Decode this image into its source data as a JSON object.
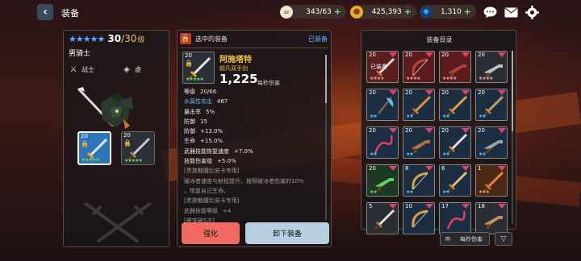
{
  "header": {
    "back_glyph": "‹",
    "title": "装备",
    "resources": [
      {
        "icon": "coffee-cup-icon",
        "value": "343/63",
        "color": "#f0e6d2"
      },
      {
        "icon": "gold-coin-icon",
        "value": "425,393",
        "color": "#f0a830"
      },
      {
        "icon": "gem-icon",
        "value": "1,310",
        "color": "#3aa0ff"
      }
    ],
    "plus": "+"
  },
  "hero": {
    "stars": 5,
    "level": "30",
    "level_max": "/30",
    "level_unit": "级",
    "name": "男骑士",
    "class_label": "战士",
    "element_label": "虚",
    "weapons": [
      {
        "level": "20",
        "stars": "★★★★★"
      },
      {
        "level": "20",
        "stars": "★★★★★"
      }
    ]
  },
  "selected": {
    "label": "选中的装备",
    "equipped_label": "已装备",
    "icon_level": "20",
    "icon_stars": "★★★★★",
    "name": "阿施塔特",
    "type": "超凡双手剑",
    "damage": "1,225",
    "damage_unit": "每秒伤害",
    "stats": [
      {
        "k": "等级",
        "v": "20/66",
        "k_style": "",
        "grey": false
      },
      {
        "k": "水属性攻击",
        "v": "467",
        "k_style": "blue",
        "grey": false
      },
      {
        "k": "暴击率",
        "v": "5%",
        "k_style": "",
        "grey": false
      },
      {
        "k": "防御",
        "v": "15",
        "k_style": "",
        "grey": false
      },
      {
        "k": "防御",
        "v": "+13.0%",
        "k_style": "",
        "grey": false
      },
      {
        "k": "生命",
        "v": "+15.0%",
        "k_style": "",
        "grey": false
      },
      {
        "k": "武器技能恢复速度",
        "v": "+7.0%",
        "k_style": "",
        "grey": false
      },
      {
        "k": "技能伤害值",
        "v": "+5.0%",
        "k_style": "",
        "grey": false
      },
      {
        "k": "[贵族魅魔比安卡专用]",
        "v": "",
        "k_style": "",
        "grey": true
      },
      {
        "k": "破冰者速度与射程提升，按照破冰者伤害的10%",
        "v": "",
        "k_style": "",
        "grey": true
      },
      {
        "k": "，恢复自己生命。",
        "v": "",
        "k_style": "",
        "grey": true
      },
      {
        "k": "[贵族魅魔比安卡专用]",
        "v": "",
        "k_style": "",
        "grey": true
      },
      {
        "k": "武器技能等级",
        "v": "+4",
        "k_style": "",
        "grey": true
      },
      {
        "k": "[需突破5次]",
        "v": "",
        "k_style": "",
        "grey": true
      }
    ],
    "upgrade_label": "强化",
    "unequip_label": "卸下装备"
  },
  "inventory": {
    "title": "装备目录",
    "items": [
      {
        "level": "20",
        "rarity": "r-red",
        "stars": "★★★★",
        "star_color": "#f0a0a0",
        "equipped": "已装备",
        "weapon": "sword",
        "color": "#d8d8d8"
      },
      {
        "level": "20",
        "rarity": "r-red",
        "stars": "★★★★",
        "star_color": "#f0a0a0",
        "equipped": "",
        "weapon": "bow",
        "color": "#c04040"
      },
      {
        "level": "20",
        "rarity": "r-red",
        "stars": "★★★★",
        "star_color": "#f0a0a0",
        "equipped": "",
        "weapon": "gun",
        "color": "#b04040"
      },
      {
        "level": "20",
        "rarity": "r-grey",
        "stars": "★★★★",
        "star_color": "#f0a0a0",
        "equipped": "",
        "weapon": "gun",
        "color": "#c0c0c0"
      },
      {
        "level": "20",
        "rarity": "r-blue",
        "stars": "★★",
        "star_color": "#5fc8ff",
        "equipped": "",
        "weapon": "axe",
        "color": "#60c0e0"
      },
      {
        "level": "20",
        "rarity": "r-blue",
        "stars": "★★",
        "star_color": "#5fc8ff",
        "equipped": "",
        "weapon": "sword",
        "color": "#e09040"
      },
      {
        "level": "20",
        "rarity": "r-blue",
        "stars": "★★",
        "star_color": "#5fc8ff",
        "equipped": "",
        "weapon": "sword",
        "color": "#e0a040"
      },
      {
        "level": "20",
        "rarity": "r-blue",
        "stars": "★★",
        "star_color": "#5fc8ff",
        "equipped": "",
        "weapon": "sword",
        "color": "#c0a060"
      },
      {
        "level": "20",
        "rarity": "r-blue",
        "stars": "★★",
        "star_color": "#5fc8ff",
        "equipped": "",
        "weapon": "whip",
        "color": "#e04060"
      },
      {
        "level": "20",
        "rarity": "r-blue",
        "stars": "★★",
        "star_color": "#5fc8ff",
        "equipped": "",
        "weapon": "gun",
        "color": "#c07040"
      },
      {
        "level": "20",
        "rarity": "r-blue",
        "stars": "★★",
        "star_color": "#5fc8ff",
        "equipped": "",
        "weapon": "sword",
        "color": "#e0e0e0"
      },
      {
        "level": "20",
        "rarity": "r-blue",
        "stars": "★★",
        "star_color": "#5fc8ff",
        "equipped": "",
        "weapon": "gun",
        "color": "#a0a0a0"
      },
      {
        "level": "20",
        "rarity": "r-green",
        "stars": "★★",
        "star_color": "#7ddc5d",
        "equipped": "",
        "weapon": "gun",
        "color": "#60d060"
      },
      {
        "level": "8",
        "rarity": "r-blue",
        "stars": "★★",
        "star_color": "#5fc8ff",
        "equipped": "",
        "weapon": "bow",
        "color": "#e0a040"
      },
      {
        "level": "6",
        "rarity": "r-blue",
        "stars": "★★",
        "star_color": "#5fc8ff",
        "equipped": "",
        "weapon": "sword",
        "color": "#e0c080"
      },
      {
        "level": "1",
        "rarity": "r-orange",
        "stars": "★★★",
        "star_color": "#f0a060",
        "equipped": "",
        "weapon": "sword",
        "color": "#f08040"
      },
      {
        "level": "5",
        "rarity": "r-grey",
        "stars": "",
        "star_color": "#ffffff",
        "equipped": "",
        "weapon": "sword",
        "color": "#e0e0e0"
      },
      {
        "level": "10",
        "rarity": "r-blue",
        "stars": "",
        "star_color": "#ffffff",
        "equipped": "",
        "weapon": "bow",
        "color": "#e0a040"
      },
      {
        "level": "17",
        "rarity": "r-blue",
        "stars": "",
        "star_color": "#ffffff",
        "equipped": "",
        "weapon": "whip",
        "color": "#e04060"
      },
      {
        "level": "18",
        "rarity": "r-grey",
        "stars": "",
        "star_color": "#ffffff",
        "equipped": "",
        "weapon": "gun",
        "color": "#c09060"
      }
    ],
    "sort_label": "每秒伤害"
  }
}
